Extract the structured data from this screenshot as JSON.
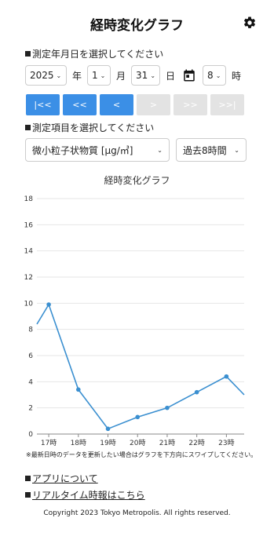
{
  "header": {
    "title": "経時変化グラフ",
    "settings_icon": "gear-icon"
  },
  "date_section": {
    "label": "測定年月日を選択してください",
    "year": "2025",
    "year_unit": "年",
    "month": "1",
    "month_unit": "月",
    "day": "31",
    "day_unit": "日",
    "calendar_icon": "calendar-icon",
    "hour": "8",
    "hour_unit": "時"
  },
  "nav_buttons": [
    {
      "label": "|<<",
      "enabled": true
    },
    {
      "label": "<<",
      "enabled": true
    },
    {
      "label": "<",
      "enabled": true
    },
    {
      "label": ">",
      "enabled": false
    },
    {
      "label": ">>",
      "enabled": false
    },
    {
      "label": ">>|",
      "enabled": false
    }
  ],
  "item_section": {
    "label": "測定項目を選択してください",
    "item": "微小粒子状物質 [µg/㎥]",
    "period": "過去8時間"
  },
  "chart_data": {
    "type": "line",
    "title": "経時変化グラフ",
    "x": [
      "17時",
      "18時",
      "19時",
      "20時",
      "21時",
      "22時",
      "23時"
    ],
    "series": [
      {
        "points": [
          [
            16.6,
            8.4
          ],
          [
            17,
            9.9
          ],
          [
            18,
            3.4
          ],
          [
            19,
            0.4
          ],
          [
            20,
            1.3
          ],
          [
            21,
            2.0
          ],
          [
            22,
            3.2
          ],
          [
            23,
            4.4
          ],
          [
            23.6,
            3.0
          ]
        ]
      }
    ],
    "yticks": [
      0,
      2,
      4,
      6,
      8,
      10,
      12,
      14,
      16,
      18
    ],
    "ylim": [
      0,
      18
    ],
    "grid": true,
    "color": "#3a8fd0"
  },
  "note": "※最新日時のデータを更新したい場合はグラフを下方向にスワイプしてください。",
  "links": {
    "about": "アプリについて",
    "realtime": "リアルタイム時報はこちら"
  },
  "footer": "Copyright 2023 Tokyo Metropolis. All rights reserved."
}
